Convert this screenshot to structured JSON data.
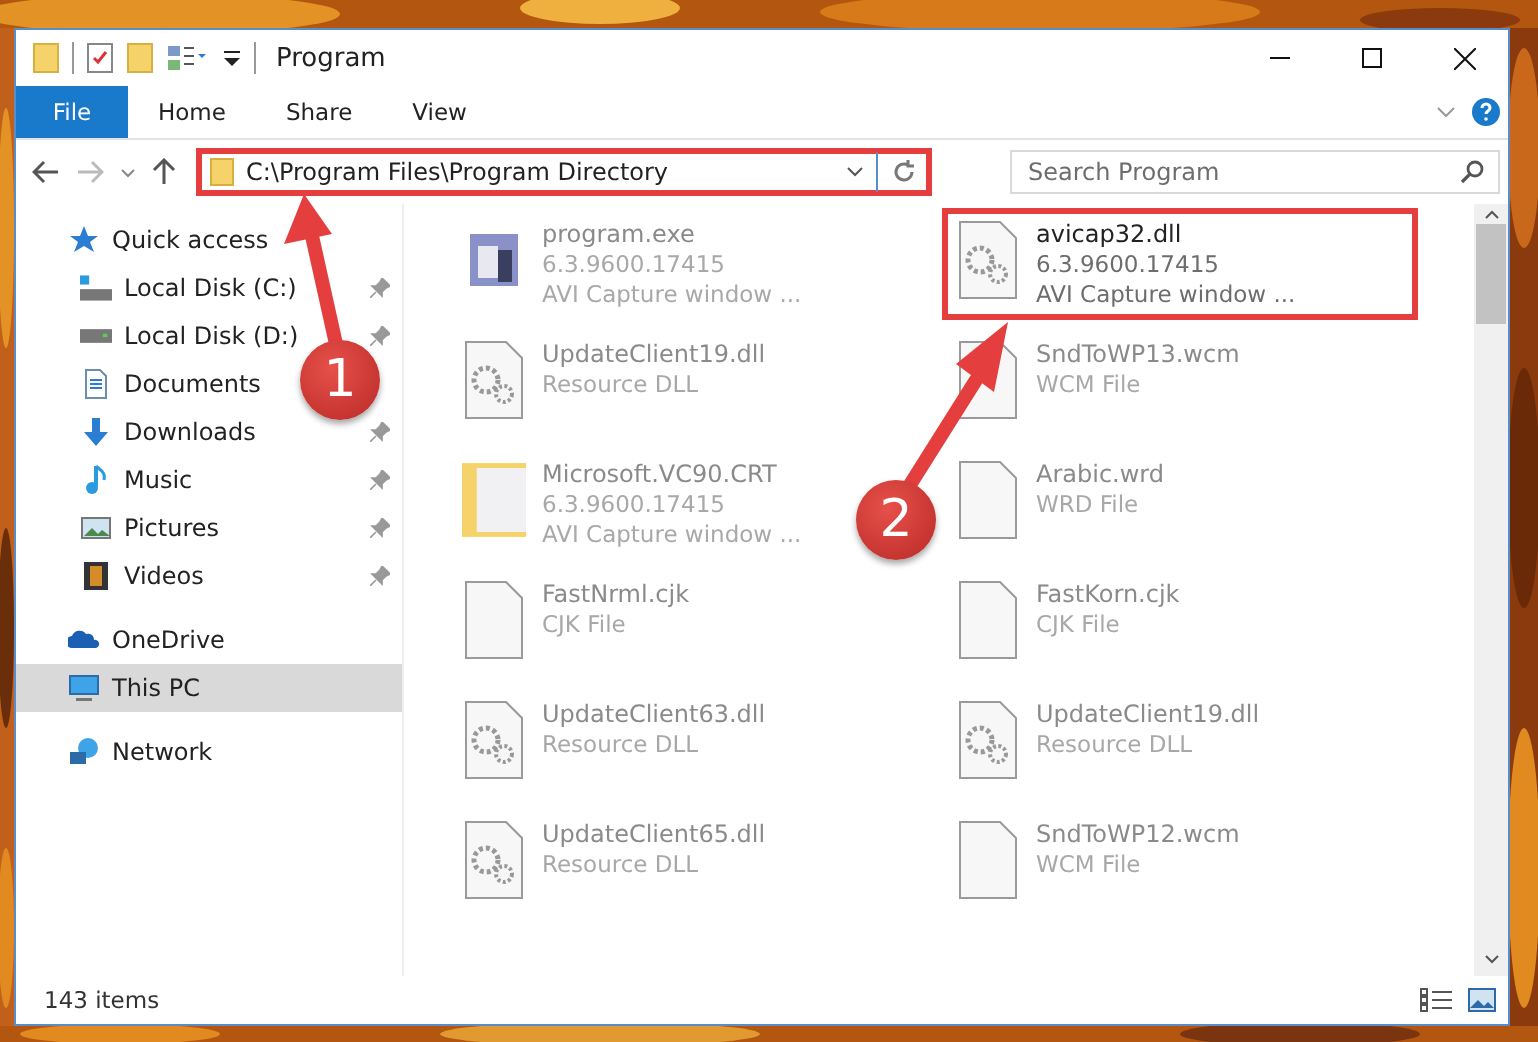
{
  "window": {
    "title": "Program"
  },
  "ribbon_tabs": [
    {
      "label": "File",
      "selected": true
    },
    {
      "label": "Home",
      "selected": false
    },
    {
      "label": "Share",
      "selected": false
    },
    {
      "label": "View",
      "selected": false
    }
  ],
  "address": {
    "path": "C:\\Program Files\\Program Directory",
    "highlighted": true
  },
  "search": {
    "placeholder": "Search Program"
  },
  "sidebar": {
    "items": [
      {
        "label": "Quick access",
        "pinned": false,
        "selected": false
      },
      {
        "label": "Local Disk (C:)",
        "pinned": true,
        "selected": false
      },
      {
        "label": "Local Disk (D:)",
        "pinned": true,
        "selected": false
      },
      {
        "label": "Documents",
        "pinned": false,
        "selected": false
      },
      {
        "label": "Downloads",
        "pinned": true,
        "selected": false
      },
      {
        "label": "Music",
        "pinned": true,
        "selected": false
      },
      {
        "label": "Pictures",
        "pinned": true,
        "selected": false
      },
      {
        "label": "Videos",
        "pinned": true,
        "selected": false
      },
      {
        "label": "OneDrive",
        "pinned": false,
        "selected": false
      },
      {
        "label": "This PC",
        "pinned": false,
        "selected": true
      },
      {
        "label": "Network",
        "pinned": false,
        "selected": false
      }
    ]
  },
  "files": [
    {
      "name": "program.exe",
      "lines": [
        "6.3.9600.17415",
        "AVI Capture window ..."
      ],
      "kind": "program",
      "highlighted": false
    },
    {
      "name": "avicap32.dll",
      "lines": [
        "6.3.9600.17415",
        "AVI Capture window ..."
      ],
      "kind": "library",
      "highlighted": true
    },
    {
      "name": "UpdateClient19.dll",
      "lines": [
        "Resource DLL"
      ],
      "kind": "library",
      "highlighted": false
    },
    {
      "name": "SndToWP13.wcm",
      "lines": [
        "WCM File"
      ],
      "kind": "file",
      "highlighted": false
    },
    {
      "name": "Microsoft.VC90.CRT",
      "lines": [
        "6.3.9600.17415",
        "AVI Capture window ..."
      ],
      "kind": "folder",
      "highlighted": false
    },
    {
      "name": "Arabic.wrd",
      "lines": [
        "WRD File"
      ],
      "kind": "file",
      "highlighted": false
    },
    {
      "name": "FastNrml.cjk",
      "lines": [
        "CJK File"
      ],
      "kind": "file",
      "highlighted": false
    },
    {
      "name": "FastKorn.cjk",
      "lines": [
        "CJK File"
      ],
      "kind": "file",
      "highlighted": false
    },
    {
      "name": "UpdateClient63.dll",
      "lines": [
        "Resource DLL"
      ],
      "kind": "library",
      "highlighted": false
    },
    {
      "name": "UpdateClient19.dll",
      "lines": [
        "Resource DLL"
      ],
      "kind": "library",
      "highlighted": false
    },
    {
      "name": "UpdateClient65.dll",
      "lines": [
        "Resource DLL"
      ],
      "kind": "library",
      "highlighted": false
    },
    {
      "name": "SndToWP12.wcm",
      "lines": [
        "WCM File"
      ],
      "kind": "file",
      "highlighted": false
    }
  ],
  "status_bar": {
    "count": "143 items"
  },
  "callouts": [
    {
      "number": "1"
    },
    {
      "number": "2"
    }
  ]
}
